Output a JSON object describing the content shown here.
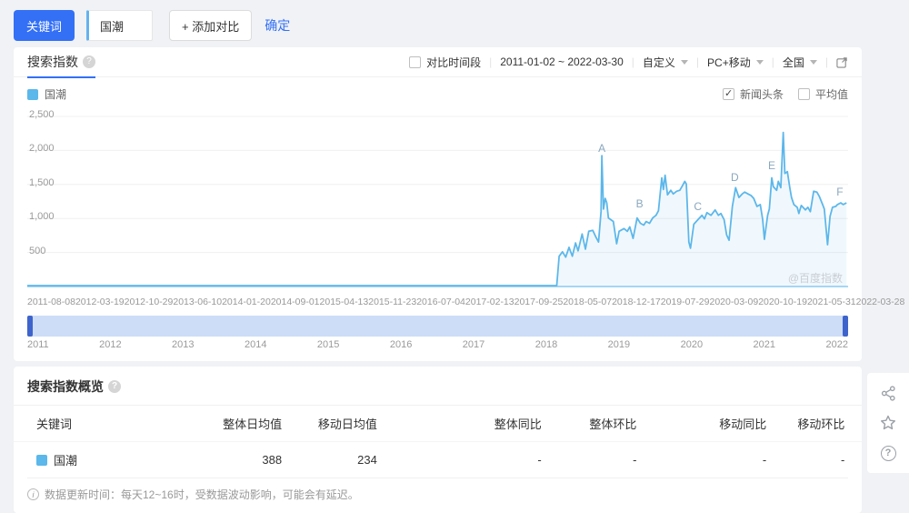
{
  "toolbar": {
    "keyword_button": "关键词",
    "keyword_value": "国潮",
    "add_compare": "+ 添加对比",
    "confirm": "确定"
  },
  "trend_card": {
    "tab": "搜索指数",
    "controls": {
      "compare_period": "对比时间段",
      "date_range": "2011-01-02 ~ 2022-03-30",
      "custom": "自定义",
      "device": "PC+移动",
      "region": "全国"
    },
    "legend_keyword": "国潮",
    "options": [
      {
        "label": "新闻头条",
        "checked": true
      },
      {
        "label": "平均值",
        "checked": false
      }
    ],
    "watermark": "@百度指数"
  },
  "chart_data": {
    "type": "line",
    "title": "搜索指数趋势",
    "series_name": "国潮",
    "ylim": [
      0,
      2500
    ],
    "grid": true,
    "line_color": "#5cb7ea",
    "fill_color": "rgba(110,186,235,0.10)",
    "axis_color": "#a9d7f3",
    "yticks": [
      {
        "label": "2,500",
        "value": 2500
      },
      {
        "label": "2,000",
        "value": 2000
      },
      {
        "label": "1,500",
        "value": 1500
      },
      {
        "label": "1,000",
        "value": 1000
      },
      {
        "label": "500",
        "value": 500
      }
    ],
    "xticks": [
      "2011-08-08",
      "2012-03-19",
      "2012-10-29",
      "2013-06-10",
      "2014-01-20",
      "2014-09-01",
      "2015-04-13",
      "2015-11-23",
      "2016-07-04",
      "2017-02-13",
      "2017-09-25",
      "2018-05-07",
      "2018-12-17",
      "2019-07-29",
      "2020-03-09",
      "2020-10-19",
      "2021-05-31",
      "2022-03-28"
    ],
    "markers": [
      {
        "label": "A",
        "x": 0.7,
        "value": 2030
      },
      {
        "label": "B",
        "x": 0.746,
        "value": 1210
      },
      {
        "label": "C",
        "x": 0.817,
        "value": 1170
      },
      {
        "label": "D",
        "x": 0.862,
        "value": 1600
      },
      {
        "label": "E",
        "x": 0.907,
        "value": 1780
      },
      {
        "label": "F",
        "x": 0.99,
        "value": 1390
      }
    ],
    "points": [
      [
        0,
        13
      ],
      [
        0.3,
        13
      ],
      [
        0.6,
        13
      ],
      [
        0.645,
        13
      ],
      [
        0.648,
        445
      ],
      [
        0.652,
        511
      ],
      [
        0.656,
        432
      ],
      [
        0.66,
        576
      ],
      [
        0.664,
        445
      ],
      [
        0.668,
        641
      ],
      [
        0.671,
        524
      ],
      [
        0.676,
        772
      ],
      [
        0.68,
        550
      ],
      [
        0.684,
        811
      ],
      [
        0.689,
        825
      ],
      [
        0.693,
        720
      ],
      [
        0.696,
        654
      ],
      [
        0.699,
        1100
      ],
      [
        0.7,
        1924
      ],
      [
        0.702,
        1139
      ],
      [
        0.704,
        1296
      ],
      [
        0.706,
        1230
      ],
      [
        0.708,
        1008
      ],
      [
        0.714,
        956
      ],
      [
        0.718,
        628
      ],
      [
        0.721,
        811
      ],
      [
        0.727,
        851
      ],
      [
        0.731,
        811
      ],
      [
        0.734,
        877
      ],
      [
        0.738,
        707
      ],
      [
        0.743,
        1008
      ],
      [
        0.747,
        929
      ],
      [
        0.751,
        903
      ],
      [
        0.754,
        956
      ],
      [
        0.758,
        929
      ],
      [
        0.762,
        1008
      ],
      [
        0.766,
        1047
      ],
      [
        0.769,
        1113
      ],
      [
        0.773,
        1597
      ],
      [
        0.775,
        1427
      ],
      [
        0.777,
        1636
      ],
      [
        0.78,
        1348
      ],
      [
        0.784,
        1414
      ],
      [
        0.787,
        1361
      ],
      [
        0.791,
        1400
      ],
      [
        0.795,
        1414
      ],
      [
        0.798,
        1479
      ],
      [
        0.801,
        1545
      ],
      [
        0.803,
        1505
      ],
      [
        0.806,
        654
      ],
      [
        0.808,
        563
      ],
      [
        0.812,
        916
      ],
      [
        0.817,
        982
      ],
      [
        0.822,
        1047
      ],
      [
        0.825,
        995
      ],
      [
        0.828,
        1086
      ],
      [
        0.833,
        1047
      ],
      [
        0.838,
        1126
      ],
      [
        0.842,
        1047
      ],
      [
        0.845,
        1073
      ],
      [
        0.849,
        982
      ],
      [
        0.852,
        759
      ],
      [
        0.855,
        680
      ],
      [
        0.859,
        1178
      ],
      [
        0.863,
        1453
      ],
      [
        0.867,
        1309
      ],
      [
        0.871,
        1361
      ],
      [
        0.874,
        1388
      ],
      [
        0.878,
        1361
      ],
      [
        0.882,
        1335
      ],
      [
        0.885,
        1296
      ],
      [
        0.889,
        1178
      ],
      [
        0.893,
        1204
      ],
      [
        0.896,
        982
      ],
      [
        0.898,
        694
      ],
      [
        0.902,
        1047
      ],
      [
        0.904,
        1139
      ],
      [
        0.907,
        1597
      ],
      [
        0.909,
        1466
      ],
      [
        0.913,
        1414
      ],
      [
        0.915,
        1545
      ],
      [
        0.918,
        1453
      ],
      [
        0.921,
        2264
      ],
      [
        0.923,
        1662
      ],
      [
        0.926,
        1688
      ],
      [
        0.929,
        1453
      ],
      [
        0.931,
        1309
      ],
      [
        0.934,
        1204
      ],
      [
        0.938,
        1165
      ],
      [
        0.94,
        1073
      ],
      [
        0.943,
        1191
      ],
      [
        0.948,
        1126
      ],
      [
        0.951,
        1165
      ],
      [
        0.954,
        1100
      ],
      [
        0.958,
        1400
      ],
      [
        0.962,
        1388
      ],
      [
        0.965,
        1322
      ],
      [
        0.969,
        1204
      ],
      [
        0.971,
        1139
      ],
      [
        0.975,
        615
      ],
      [
        0.978,
        1034
      ],
      [
        0.981,
        1165
      ],
      [
        0.985,
        1178
      ],
      [
        0.987,
        1204
      ],
      [
        0.991,
        1230
      ],
      [
        0.994,
        1204
      ],
      [
        0.998,
        1230
      ]
    ]
  },
  "slider": {
    "years": [
      "2011",
      "2012",
      "2013",
      "2014",
      "2015",
      "2016",
      "2017",
      "2018",
      "2019",
      "2020",
      "2021",
      "2022"
    ]
  },
  "overview_card": {
    "title": "搜索指数概览",
    "table": {
      "headers": [
        "关键词",
        "整体日均值",
        "移动日均值",
        "整体同比",
        "整体环比",
        "移动同比",
        "移动环比"
      ],
      "rows": [
        {
          "keyword": "国潮",
          "values": [
            "388",
            "234",
            "-",
            "-",
            "-",
            "-"
          ]
        }
      ]
    },
    "note": "数据更新时间：每天12~16时，受数据波动影响，可能会有延迟。"
  },
  "colors": {
    "accent_blue": "#3370f6",
    "series_blue": "#5cb7ea",
    "slider_band": "#cdddf8",
    "slider_handle": "#3e64cc"
  }
}
